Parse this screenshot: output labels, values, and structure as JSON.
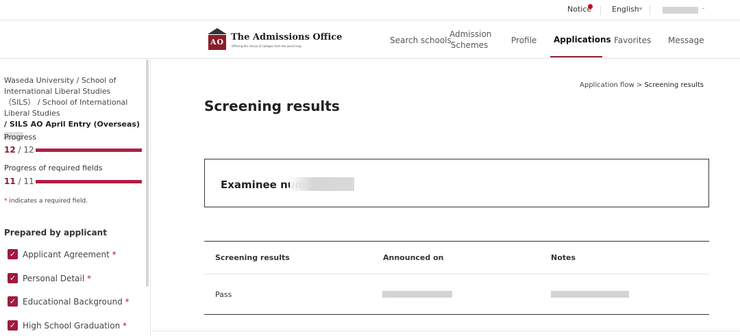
{
  "utility": {
    "notice_label": "Notice",
    "language_label": "English"
  },
  "brand": {
    "name": "The Admissions Office",
    "logo_letters": "AO",
    "tagline": "Offering the choice of colleges from the world map"
  },
  "nav": {
    "items": [
      {
        "label": "Search schools"
      },
      {
        "label": "Admission\nSchemes"
      },
      {
        "label": "Profile"
      },
      {
        "label": "Applications",
        "active": true
      },
      {
        "label": "Favorites"
      },
      {
        "label": "Message"
      }
    ]
  },
  "sidebar": {
    "program_line1": "Waseda University / School of International Liberal Studies（SILS） / School of International Liberal Studies",
    "program_line2": "/ SILS AO April Entry (Overseas)",
    "progress_label": "Progress",
    "progress_done": "12",
    "progress_total": " / 12",
    "progress_fraction": 1.0,
    "required_label": "Progress of required fields",
    "required_done": "11",
    "required_total": " / 11",
    "required_fraction": 1.0,
    "required_note_mark": "*",
    "required_note": " indicates a required field.",
    "section_title": "Prepared by applicant",
    "items": [
      {
        "label": "Applicant Agreement",
        "required": "*"
      },
      {
        "label": "Personal Detail",
        "required": "*"
      },
      {
        "label": "Educational Background",
        "required": "*"
      },
      {
        "label": "High School Graduation",
        "required": "*"
      }
    ],
    "check_mark": "✓"
  },
  "breadcrumb": {
    "parent": "Application flow",
    "separator": ">",
    "current": "Screening results"
  },
  "page": {
    "title": "Screening results",
    "examinee_label": "Examinee num"
  },
  "results_table": {
    "headers": [
      "Screening results",
      "Announced on",
      "Notes"
    ],
    "rows": [
      {
        "result": "Pass"
      }
    ]
  },
  "colors": {
    "accent": "#8b1d2c",
    "progress": "#b01e44",
    "checkbox": "#9e1b3f",
    "notice_dot": "#d0021b"
  }
}
